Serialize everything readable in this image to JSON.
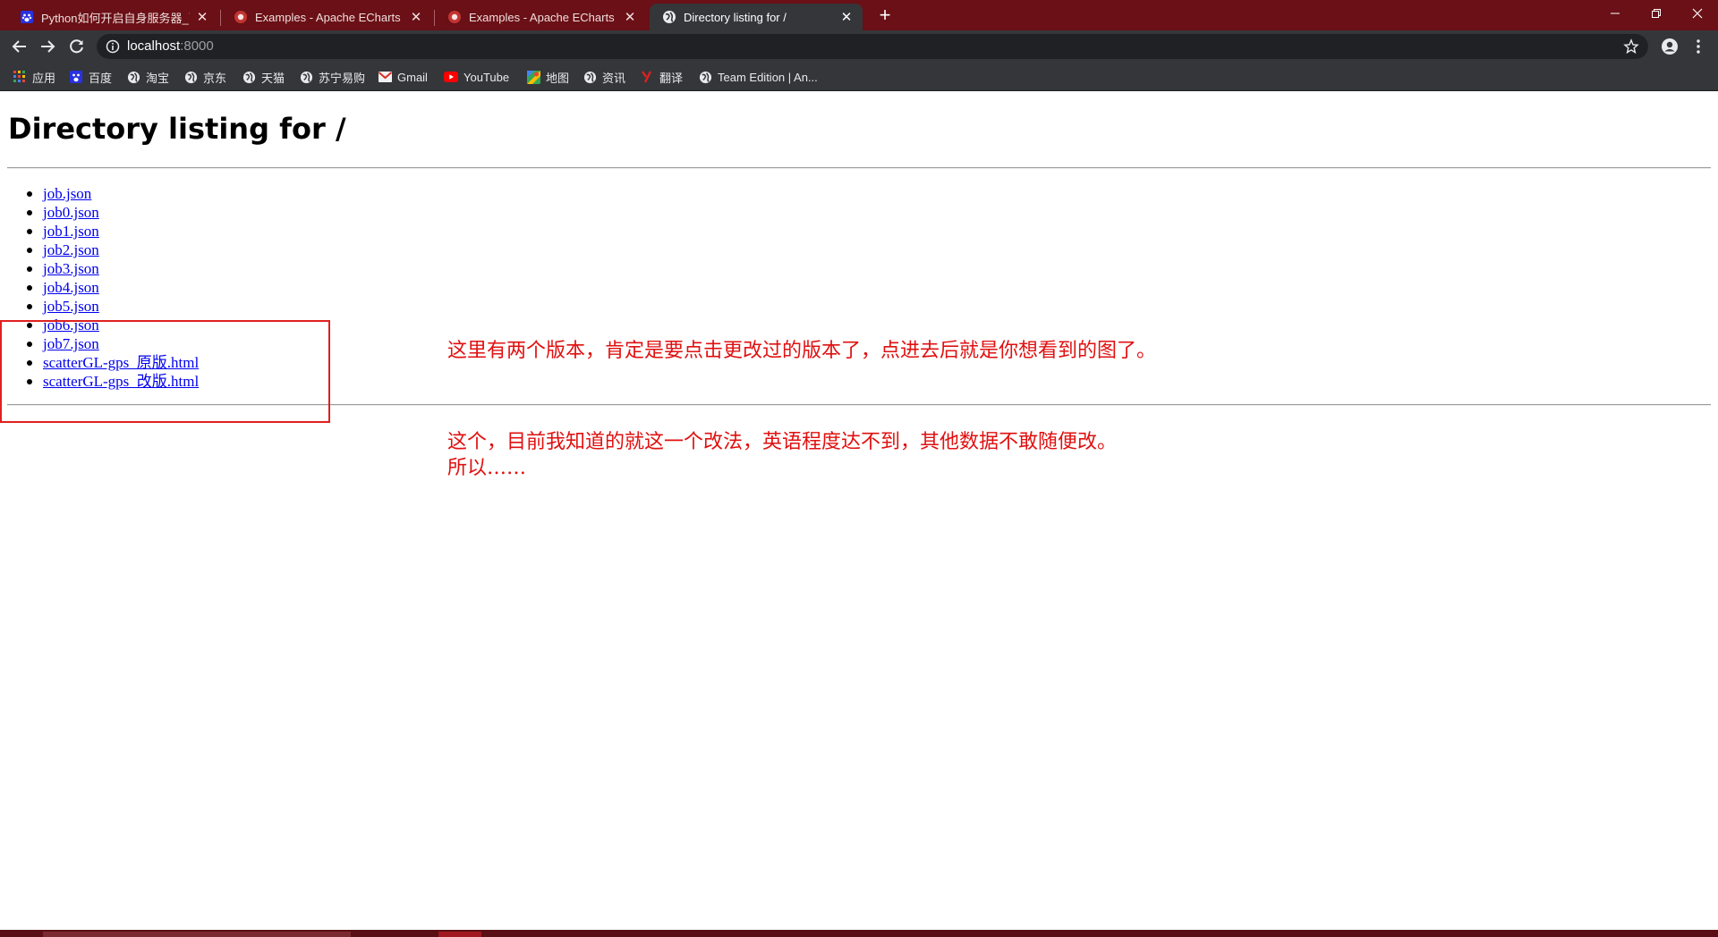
{
  "browser": {
    "tabs": [
      {
        "title": "Python如何开启自身服务器_百度",
        "favicon": "baidu-paw-icon",
        "active": false
      },
      {
        "title": "Examples - Apache ECharts (in",
        "favicon": "echarts-icon",
        "active": false
      },
      {
        "title": "Examples - Apache ECharts (in",
        "favicon": "echarts-icon",
        "active": false
      },
      {
        "title": "Directory listing for /",
        "favicon": "globe-icon",
        "active": true
      }
    ],
    "colors": {
      "tabstrip": "#6a1016",
      "toolbar": "#35363a",
      "omnibox": "#202124"
    },
    "address": {
      "host": "localhost",
      "port": ":8000"
    },
    "bookmarks": [
      {
        "label": "应用",
        "icon": "apps-grid-icon"
      },
      {
        "label": "百度",
        "icon": "baidu-paw-icon"
      },
      {
        "label": "淘宝",
        "icon": "globe-icon"
      },
      {
        "label": "京东",
        "icon": "globe-icon"
      },
      {
        "label": "天猫",
        "icon": "globe-icon"
      },
      {
        "label": "苏宁易购",
        "icon": "globe-icon"
      },
      {
        "label": "Gmail",
        "icon": "gmail-icon"
      },
      {
        "label": "YouTube",
        "icon": "youtube-icon"
      },
      {
        "label": "地图",
        "icon": "maps-icon"
      },
      {
        "label": "资讯",
        "icon": "globe-icon"
      },
      {
        "label": "翻译",
        "icon": "youdao-icon"
      },
      {
        "label": "Team Edition | An...",
        "icon": "globe-icon"
      }
    ]
  },
  "page": {
    "title": "Directory listing for /",
    "files": [
      "job.json",
      "job0.json",
      "job1.json",
      "job2.json",
      "job3.json",
      "job4.json",
      "job5.json",
      "job6.json",
      "job7.json",
      "scatterGL-gps_原版.html",
      "scatterGL-gps_改版.html"
    ],
    "annotations": {
      "note1": "这里有两个版本，肯定是要点击更改过的版本了，点进去后就是你想看到的图了。",
      "note2_line1": "这个，目前我知道的就这一个改法，英语程度达不到，其他数据不敢随便改。",
      "note2_line2": "所以……",
      "color": "#e01010"
    }
  }
}
